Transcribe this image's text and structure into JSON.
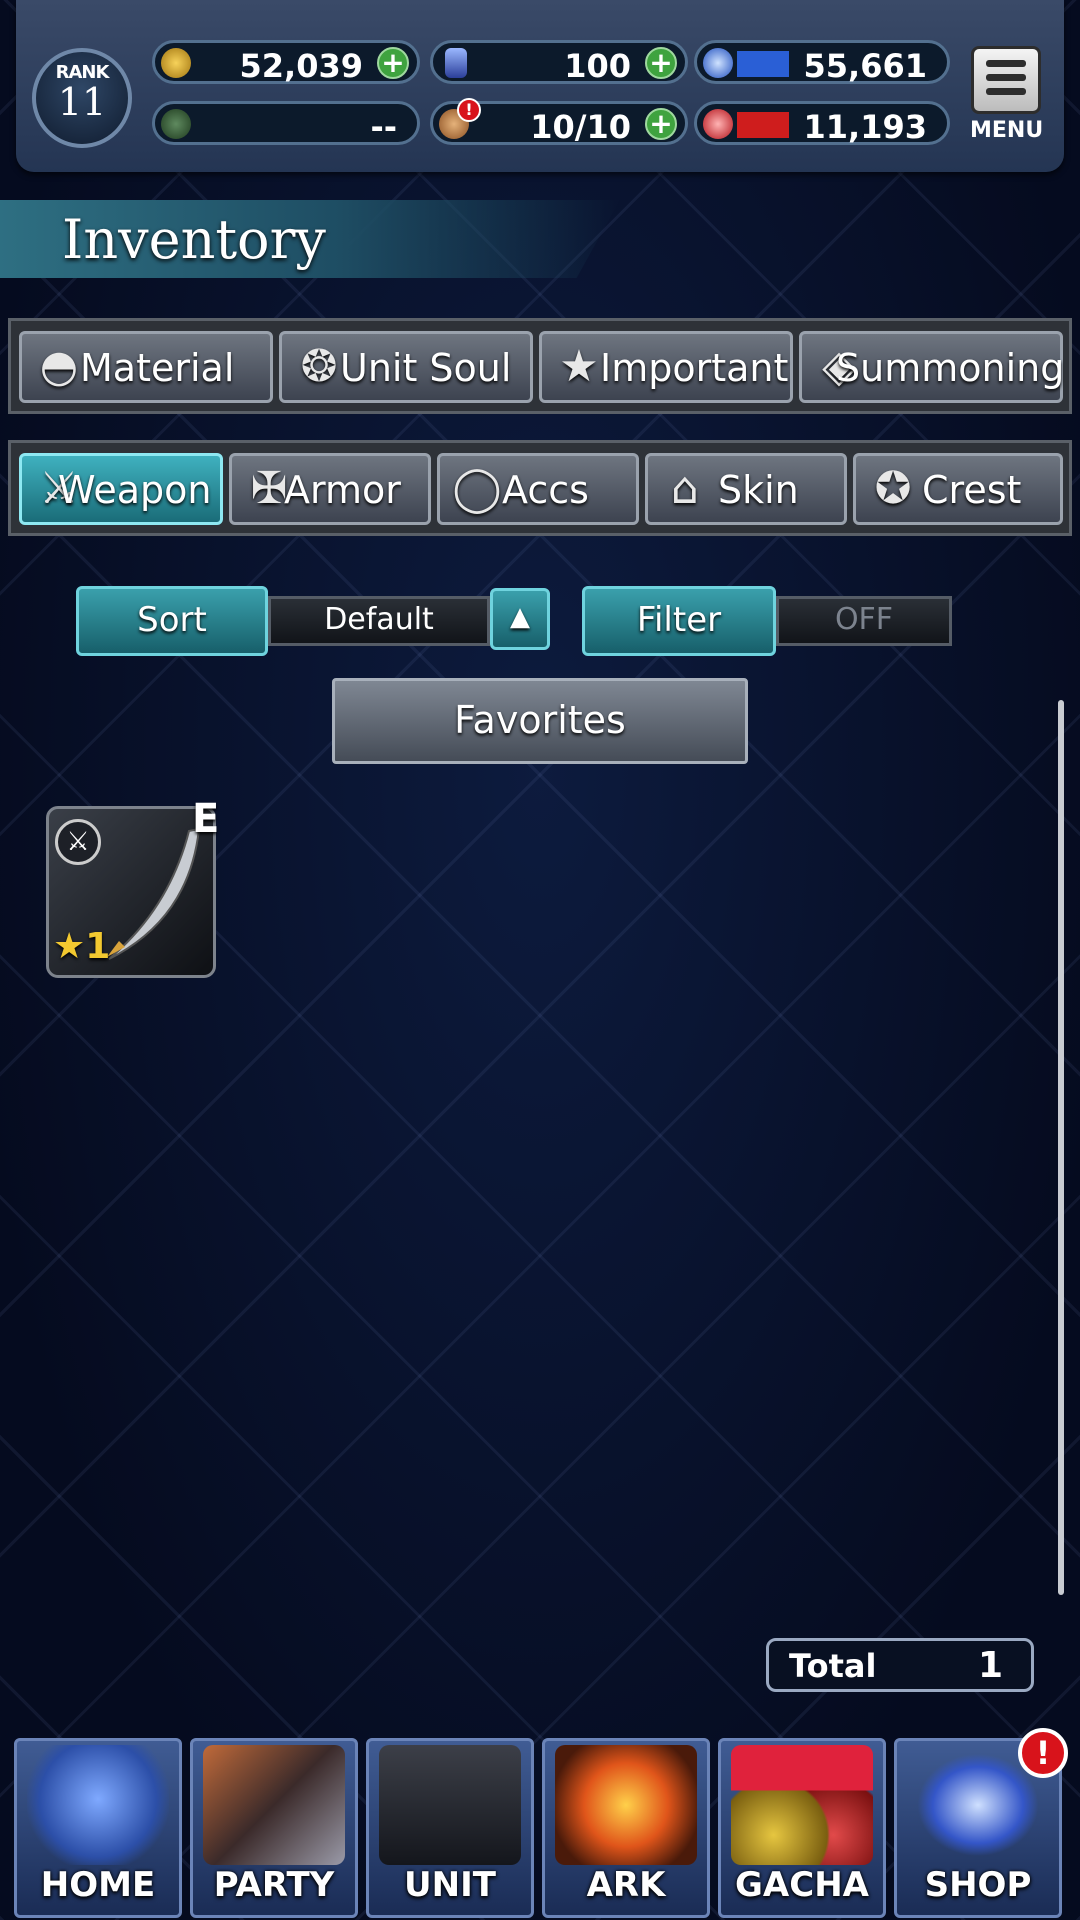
{
  "header": {
    "rank_label": "RANK",
    "rank_value": "11",
    "gil": "52,039",
    "stamina_gauge": "--",
    "crystals": "100",
    "tickets": "10/10",
    "blue_stat": "55,661",
    "red_stat": "11,193",
    "menu_label": "MENU"
  },
  "page": {
    "title": "Inventory"
  },
  "category_tabs": [
    {
      "label": "Material",
      "icon": "pouch-icon"
    },
    {
      "label": "Unit Soul",
      "icon": "soul-icon"
    },
    {
      "label": "Important",
      "icon": "star-icon"
    },
    {
      "label": "Summoning",
      "icon": "dragon-icon"
    }
  ],
  "equipment_tabs": [
    {
      "label": "Weapon",
      "icon": "sword-icon",
      "active": true
    },
    {
      "label": "Armor",
      "icon": "armor-icon"
    },
    {
      "label": "Accs",
      "icon": "necklace-icon"
    },
    {
      "label": "Skin",
      "icon": "hanger-icon"
    },
    {
      "label": "Crest",
      "icon": "crest-icon"
    }
  ],
  "sort": {
    "label": "Sort",
    "value": "Default"
  },
  "filter": {
    "label": "Filter",
    "value": "OFF"
  },
  "favorites_label": "Favorites",
  "items": [
    {
      "rarity": "1",
      "equipped_mark": "E",
      "type_icon": "sword-icon"
    }
  ],
  "total": {
    "label": "Total",
    "value": "1"
  },
  "nav": [
    {
      "label": "HOME"
    },
    {
      "label": "PARTY"
    },
    {
      "label": "UNIT"
    },
    {
      "label": "ARK"
    },
    {
      "label": "GACHA"
    },
    {
      "label": "SHOP"
    }
  ],
  "colors": {
    "accent": "#3fb1bf",
    "plus_green": "#3fa33f",
    "alert_red": "#d8131b",
    "gold_star": "#f3c930"
  }
}
